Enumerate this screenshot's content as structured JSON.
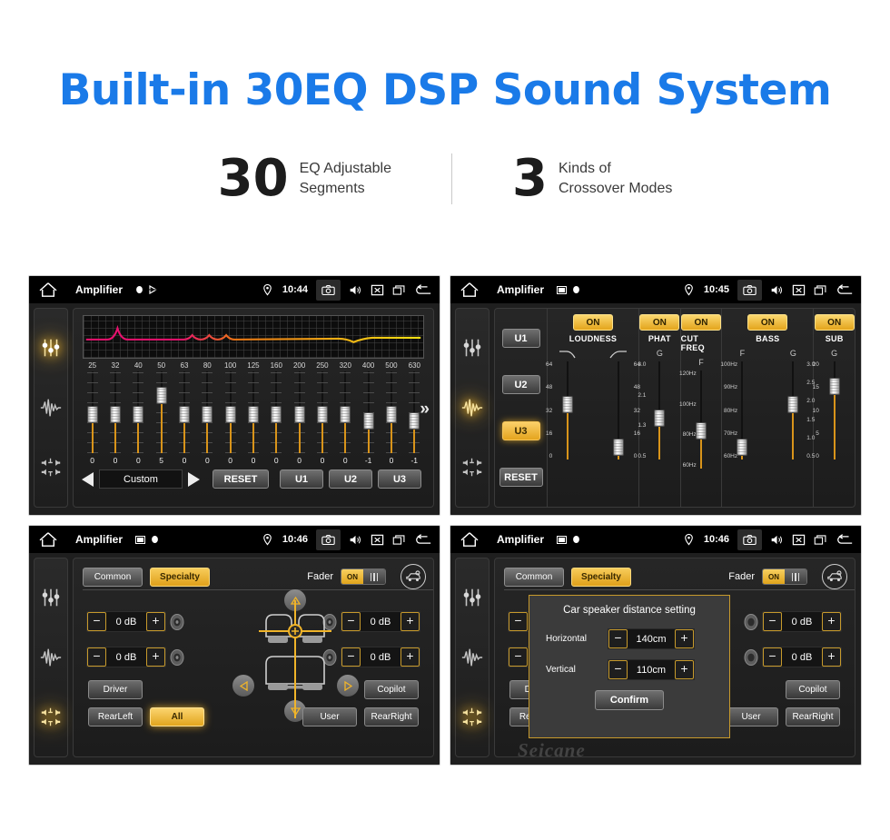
{
  "hero": {
    "title": "Built-in 30EQ DSP Sound System",
    "stats": [
      {
        "number": "30",
        "line1": "EQ Adjustable",
        "line2": "Segments"
      },
      {
        "number": "3",
        "line1": "Kinds of",
        "line2": "Crossover Modes"
      }
    ]
  },
  "colors": {
    "title_blue": "#1a7ae8",
    "accent_amber": "#e8a82a",
    "panel_bg": "#1f1f1f",
    "statusbar_bg": "#000000"
  },
  "statusbar": {
    "home_icon": "home-icon",
    "app_title": "Amplifier",
    "mini_icons": [
      "sd-card-icon",
      "bluetooth-dot-icon"
    ],
    "location_icon": "location-pin-icon",
    "icons": [
      "camera-icon",
      "volume-icon",
      "close-box-icon",
      "recents-icon",
      "back-arrow-icon"
    ]
  },
  "sidebar": {
    "items": [
      {
        "name": "equalizer-icon",
        "label": "Equalizer"
      },
      {
        "name": "waveform-icon",
        "label": "Crossover"
      },
      {
        "name": "balance-icon",
        "label": "Balance"
      }
    ]
  },
  "panels": [
    {
      "id": "eq",
      "time": "10:44",
      "active_sidebar": 0,
      "eq": {
        "frequencies": [
          "25",
          "32",
          "40",
          "50",
          "63",
          "80",
          "100",
          "125",
          "160",
          "200",
          "250",
          "320",
          "400",
          "500",
          "630"
        ],
        "values": [
          "0",
          "0",
          "0",
          "5",
          "0",
          "0",
          "0",
          "0",
          "0",
          "0",
          "0",
          "0",
          "-1",
          "0",
          "-1"
        ],
        "knob_positions": [
          38,
          38,
          38,
          17,
          38,
          38,
          38,
          38,
          38,
          38,
          38,
          38,
          45,
          38,
          45
        ],
        "preset": "Custom",
        "prev_icon": "triangle-left-icon",
        "next_icon": "triangle-right-icon",
        "reset_label": "RESET",
        "user_presets": [
          "U1",
          "U2",
          "U3"
        ],
        "more_icon": "chevron-double-right-icon"
      }
    },
    {
      "id": "crossover",
      "time": "10:45",
      "active_sidebar": 1,
      "crossover": {
        "presets": [
          {
            "label": "U1",
            "selected": false
          },
          {
            "label": "U2",
            "selected": false
          },
          {
            "label": "U3",
            "selected": true
          }
        ],
        "reset_label": "RESET",
        "sections": [
          {
            "name": "LOUDNESS",
            "on_label": "ON",
            "axes": [
              {
                "label": "",
                "curve": "lowpass-curve-icon",
                "scale": [
                  "64",
                  "48",
                  "32",
                  "16",
                  "0"
                ],
                "knob_pct": 44,
                "side": "left"
              },
              {
                "label": "",
                "curve": "highpass-curve-icon",
                "scale": [
                  "64",
                  "48",
                  "32",
                  "16",
                  "0"
                ],
                "knob_pct": 88,
                "side": "right"
              }
            ]
          },
          {
            "name": "PHAT",
            "on_label": "ON",
            "axes": [
              {
                "label": "G",
                "curve": "",
                "scale": [
                  "3.0",
                  "2.1",
                  "1.3",
                  "0.5"
                ],
                "knob_pct": 58,
                "side": "left"
              }
            ]
          },
          {
            "name": "CUT FREQ",
            "on_label": "ON",
            "axes": [
              {
                "label": "F",
                "curve": "",
                "scale": [
                  "120Hz",
                  "100Hz",
                  "80Hz",
                  "60Hz"
                ],
                "knob_pct": 62,
                "side": "left"
              }
            ]
          },
          {
            "name": "BASS",
            "on_label": "ON",
            "axes": [
              {
                "label": "F",
                "curve": "",
                "scale": [
                  "100Hz",
                  "90Hz",
                  "80Hz",
                  "70Hz",
                  "60Hz"
                ],
                "knob_pct": 88,
                "side": "left"
              },
              {
                "label": "G",
                "curve": "",
                "scale": [
                  "3.0",
                  "2.5",
                  "2.0",
                  "1.5",
                  "1.0",
                  "0.5"
                ],
                "knob_pct": 44,
                "side": "right"
              }
            ]
          },
          {
            "name": "SUB",
            "on_label": "ON",
            "axes": [
              {
                "label": "G",
                "curve": "",
                "scale": [
                  "20",
                  "15",
                  "10",
                  "5",
                  "0"
                ],
                "knob_pct": 26,
                "side": "left"
              }
            ]
          }
        ]
      }
    },
    {
      "id": "balance",
      "time": "10:46",
      "active_sidebar": 2,
      "balance": {
        "tabs": [
          {
            "label": "Common",
            "selected": false
          },
          {
            "label": "Specialty",
            "selected": true
          }
        ],
        "fader_label": "Fader",
        "fader_state": "ON",
        "car_setting_icon": "car-speaker-setting-icon",
        "db_controls": [
          {
            "position": "front-left",
            "minus": "−",
            "value": "0 dB",
            "plus": "+",
            "speaker_icon": "speaker-icon"
          },
          {
            "position": "rear-left",
            "minus": "−",
            "value": "0 dB",
            "plus": "+",
            "speaker_icon": "speaker-icon"
          },
          {
            "position": "front-right",
            "minus": "−",
            "value": "0 dB",
            "plus": "+",
            "speaker_icon": "speaker-icon"
          },
          {
            "position": "rear-right",
            "minus": "−",
            "value": "0 dB",
            "plus": "+",
            "speaker_icon": "speaker-icon"
          }
        ],
        "nudge": {
          "up": "triangle-up-icon",
          "down": "triangle-down-icon",
          "left": "triangle-left-icon",
          "right": "triangle-right-icon"
        },
        "seat_diagram_icon": "car-seats-diagram",
        "position_buttons": [
          {
            "label": "Driver",
            "selected": false
          },
          {
            "label": "Copilot",
            "selected": false
          },
          {
            "label": "RearLeft",
            "selected": false
          },
          {
            "label": "All",
            "selected": true
          },
          {
            "label": "User",
            "selected": false
          },
          {
            "label": "RearRight",
            "selected": false
          }
        ]
      }
    },
    {
      "id": "balance-dialog",
      "time": "10:46",
      "active_sidebar": 2,
      "dialog": {
        "title": "Car speaker distance setting",
        "rows": [
          {
            "label": "Horizontal",
            "minus": "−",
            "value": "140cm",
            "plus": "+"
          },
          {
            "label": "Vertical",
            "minus": "−",
            "value": "110cm",
            "plus": "+"
          }
        ],
        "confirm_label": "Confirm"
      },
      "watermark": "Seicane"
    }
  ]
}
